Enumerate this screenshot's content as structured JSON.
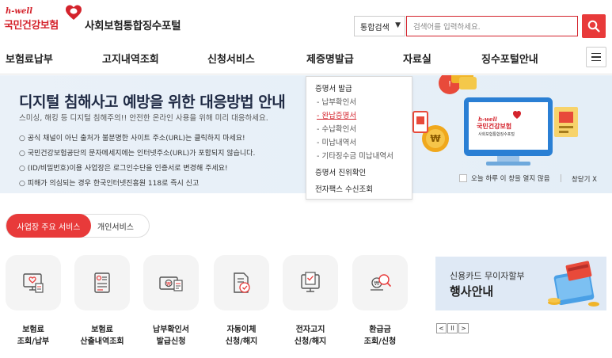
{
  "header": {
    "logo_hwell": "h-well",
    "logo_nhis": "국민건강보험",
    "portal_title": "사회보험통합징수포털",
    "search": {
      "scope_selected": "통합검색",
      "placeholder": "검색어를 입력하세요."
    }
  },
  "gnb": {
    "items": [
      "보험료납부",
      "고지내역조회",
      "신청서비스",
      "제증명발급",
      "자료실",
      "징수포털안내"
    ]
  },
  "banner": {
    "title": "디지털 침해사고 예방을 위한 대응방법 안내",
    "subtitle": "스미싱, 해킹 등 디지털 침해주의!! 안전한 온라인 사용을 위해 미리 대응하세요.",
    "bullets": [
      "공식 채널이 아닌 출처가 불분명한 사이트 주소(URL)는 클릭하지 마세요!",
      "국민건강보험공단의 문자메세지에는 인터넷주소(URL)가 포함되지 않습니다.",
      "(ID/비밀번호)이용 사업장은 로그인수단을 인증서로 변경해 주세요!",
      "피해가 의심되는 경우 한국인터넷진흥원 118로 즉시 신고"
    ],
    "illustration_logo": "국민건강보험",
    "illustration_logo_small": "h-well",
    "illustration_sub": "사회보험통합징수포털",
    "today_close": "오늘 하루 이 창을 열지 않음",
    "close": "창닫기 X"
  },
  "dropdown": {
    "group1": "증명서 발급",
    "subs": [
      "- 납부확인서",
      "- 완납증명서",
      "- 수납확인서",
      "- 미납내역서",
      "- 기타징수금 미납내역서"
    ],
    "active_index": 1,
    "group2": "증명서 진위확인",
    "group3": "전자팩스 수신조회"
  },
  "tabs": {
    "active": "사업장 주요 서비스",
    "inactive": "개인서비스"
  },
  "services": [
    {
      "line1": "보험료",
      "line2": "조회/납부",
      "icon": "bill-monitor-icon"
    },
    {
      "line1": "보험료",
      "line2": "산출내역조회",
      "icon": "calculation-document-icon"
    },
    {
      "line1": "납부확인서",
      "line2": "발급신청",
      "icon": "money-certificate-icon"
    },
    {
      "line1": "자동이체",
      "line2": "신청/해지",
      "icon": "auto-transfer-document-icon"
    },
    {
      "line1": "전자고지",
      "line2": "신청/해지",
      "icon": "electronic-notice-icon"
    },
    {
      "line1": "환급금",
      "line2": "조회/신청",
      "icon": "refund-search-icon"
    }
  ],
  "ad": {
    "line1": "신용카드 무이자할부",
    "line2": "행사안내"
  },
  "pager": {
    "prev": "<",
    "pause": "II",
    "next": ">"
  },
  "colors": {
    "brand_red": "#d4232c",
    "accent_red": "#e83a3a",
    "banner_bg": "#e7f0f8"
  }
}
